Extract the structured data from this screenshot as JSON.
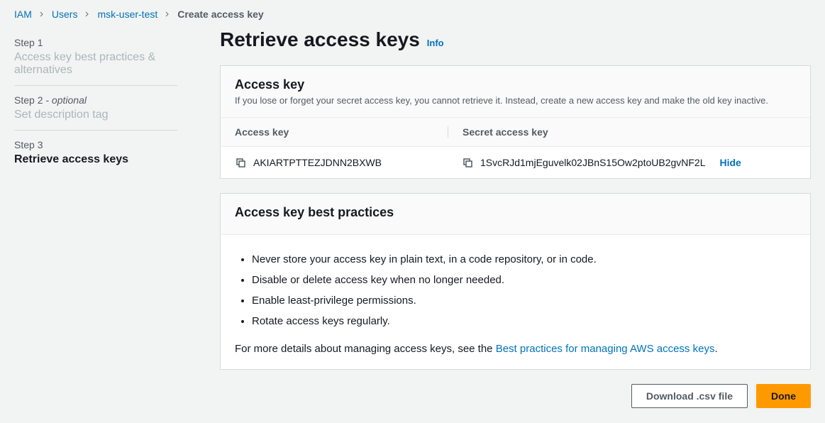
{
  "breadcrumb": {
    "items": [
      "IAM",
      "Users",
      "msk-user-test"
    ],
    "current": "Create access key"
  },
  "sidebar": {
    "steps": [
      {
        "label": "Step 1",
        "title": "Access key best practices & alternatives",
        "optional": false
      },
      {
        "label": "Step 2",
        "title": "Set description tag",
        "optional": true,
        "optional_text": "- optional"
      },
      {
        "label": "Step 3",
        "title": "Retrieve access keys",
        "optional": false
      }
    ]
  },
  "page": {
    "title": "Retrieve access keys",
    "info": "Info"
  },
  "access_key_panel": {
    "title": "Access key",
    "description": "If you lose or forget your secret access key, you cannot retrieve it. Instead, create a new access key and make the old key inactive.",
    "col1": "Access key",
    "col2": "Secret access key",
    "access_key": "AKIARTPTTEZJDNN2BXWB",
    "secret_key": "1SvcRJd1mjEguvelk02JBnS15Ow2ptoUB2gvNF2L",
    "hide": "Hide"
  },
  "best_practices": {
    "title": "Access key best practices",
    "items": [
      "Never store your access key in plain text, in a code repository, or in code.",
      "Disable or delete access key when no longer needed.",
      "Enable least-privilege permissions.",
      "Rotate access keys regularly."
    ],
    "more_prefix": "For more details about managing access keys, see the ",
    "link_text": "Best practices for managing AWS access keys",
    "more_suffix": "."
  },
  "buttons": {
    "download": "Download .csv file",
    "done": "Done"
  }
}
